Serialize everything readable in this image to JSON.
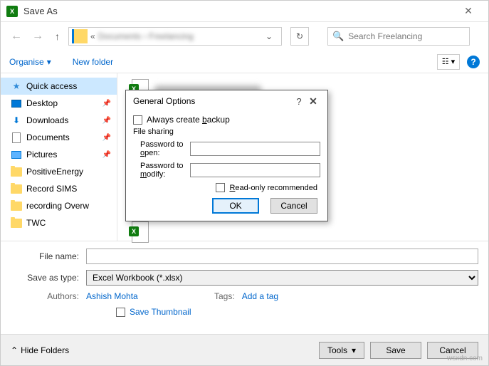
{
  "window": {
    "title": "Save As"
  },
  "nav": {
    "breadcrumb": "Documents › Freelancing",
    "refresh_icon": "↻"
  },
  "search": {
    "placeholder": "Search Freelancing"
  },
  "toolbar": {
    "organise": "Organise",
    "new_folder": "New folder"
  },
  "sidebar": {
    "items": [
      {
        "label": "Quick access",
        "pinned": false
      },
      {
        "label": "Desktop",
        "pinned": true
      },
      {
        "label": "Downloads",
        "pinned": true
      },
      {
        "label": "Documents",
        "pinned": true
      },
      {
        "label": "Pictures",
        "pinned": true
      },
      {
        "label": "PositiveEnergy",
        "pinned": false
      },
      {
        "label": "Record SIMS",
        "pinned": false
      },
      {
        "label": "recording Overw",
        "pinned": false
      },
      {
        "label": "TWC",
        "pinned": false
      }
    ]
  },
  "form": {
    "filename_label": "File name:",
    "filename_value": "",
    "save_as_type_label": "Save as type:",
    "save_as_type_value": "Excel Workbook (*.xlsx)",
    "authors_label": "Authors:",
    "authors_value": "Ashish Mohta",
    "tags_label": "Tags:",
    "tags_value": "Add a tag",
    "save_thumbnail": "Save Thumbnail"
  },
  "footer": {
    "hide_folders": "Hide Folders",
    "tools": "Tools",
    "save": "Save",
    "cancel": "Cancel"
  },
  "dialog": {
    "title": "General Options",
    "always_backup": "Always create backup",
    "file_sharing": "File sharing",
    "password_open": "Password to open:",
    "password_modify": "Password to modify:",
    "read_only": "Read-only recommended",
    "ok": "OK",
    "cancel": "Cancel"
  },
  "watermark": "wsxdn.com"
}
